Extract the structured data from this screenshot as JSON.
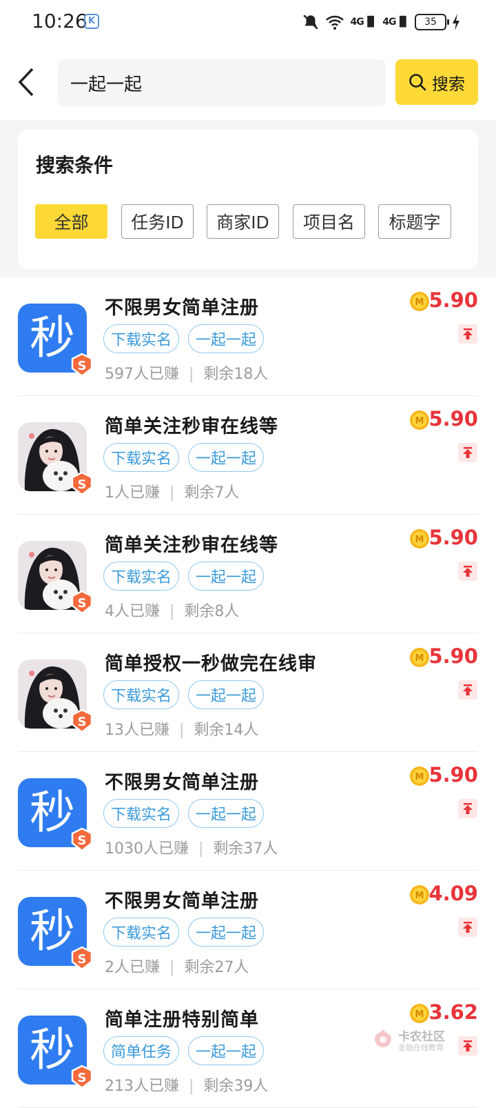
{
  "status_bar": {
    "time": "10:26",
    "battery": "35"
  },
  "header": {
    "search_value": "一起一起",
    "search_button": "搜索"
  },
  "filter": {
    "title": "搜索条件",
    "chips": [
      "全部",
      "任务ID",
      "商家ID",
      "项目名",
      "标题字"
    ],
    "active_chip": "全部"
  },
  "tasks": [
    {
      "avatar": "miao-logo",
      "title": "不限男女简单注册",
      "tags": [
        "下载实名",
        "一起一起"
      ],
      "earned": "597人已赚",
      "remaining": "剩余18人",
      "price": "5.90"
    },
    {
      "avatar": "girl-photo",
      "title": "简单关注秒审在线等",
      "tags": [
        "下载实名",
        "一起一起"
      ],
      "earned": "1人已赚",
      "remaining": "剩余7人",
      "price": "5.90"
    },
    {
      "avatar": "girl-photo",
      "title": "简单关注秒审在线等",
      "tags": [
        "下载实名",
        "一起一起"
      ],
      "earned": "4人已赚",
      "remaining": "剩余8人",
      "price": "5.90"
    },
    {
      "avatar": "girl-photo",
      "title": "简单授权一秒做完在线审",
      "tags": [
        "下载实名",
        "一起一起"
      ],
      "earned": "13人已赚",
      "remaining": "剩余14人",
      "price": "5.90"
    },
    {
      "avatar": "miao-logo",
      "title": "不限男女简单注册",
      "tags": [
        "下载实名",
        "一起一起"
      ],
      "earned": "1030人已赚",
      "remaining": "剩余37人",
      "price": "5.90"
    },
    {
      "avatar": "miao-logo",
      "title": "不限男女简单注册",
      "tags": [
        "下载实名",
        "一起一起"
      ],
      "earned": "2人已赚",
      "remaining": "剩余27人",
      "price": "4.09"
    },
    {
      "avatar": "miao-logo",
      "title": "简单注册特别简单",
      "tags": [
        "简单任务",
        "一起一起"
      ],
      "earned": "213人已赚",
      "remaining": "剩余39人",
      "price": "3.62"
    }
  ],
  "avatar_logo_char": "秒",
  "coin_letter": "M",
  "badge_letter": "S",
  "watermark": {
    "title": "卡农社区",
    "subtitle": "金融在线教育"
  },
  "colors": {
    "accent_yellow": "#fcd937",
    "price_red": "#e8343a",
    "tag_blue": "#3a9ad9",
    "logo_blue": "#2f7cf0"
  }
}
